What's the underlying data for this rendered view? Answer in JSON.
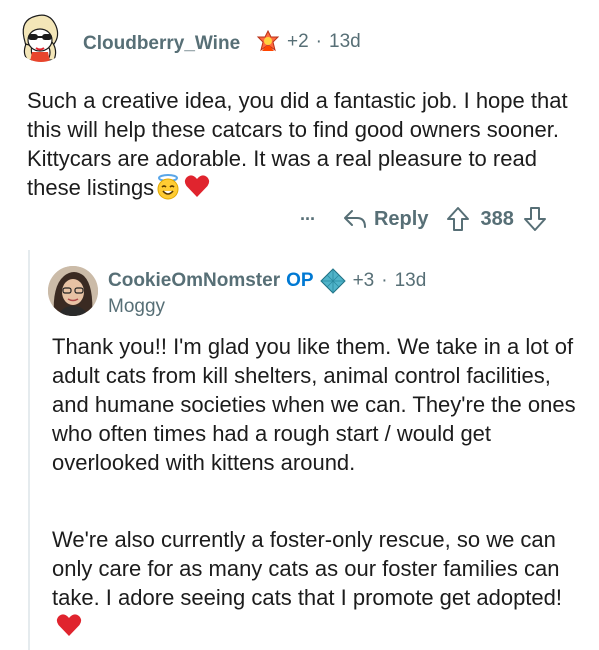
{
  "comment1": {
    "username": "Cloudberry_Wine",
    "award_count": "+2",
    "separator": "·",
    "age": "13d",
    "text": "Such a creative idea, you did a fantastic job. I hope that this will help these catcars to find good owners sooner. Kittycars are adorable. It was a real pleasure to read these listings",
    "more_label": "···",
    "reply_label": "Reply",
    "score": "388"
  },
  "comment2": {
    "username": "CookieOmNomster",
    "op_label": "OP",
    "award_count": "+3",
    "separator": "·",
    "age": "13d",
    "flair": "Moggy",
    "paragraph1": "Thank you!! I'm glad you like them. We take in a lot of adult cats from kill shelters, animal control facilities, and humane societies when we can. They're the ones who often times had a rough start / would get overlooked with kittens around.",
    "paragraph2": "We're also currently a foster-only rescue, so we can only care for as many cats as our foster families can take. I adore seeing cats that I promote get adopted!"
  },
  "colors": {
    "meta_gray": "#576f76",
    "op_blue": "#0079d3",
    "heart_red": "#e0242e"
  }
}
